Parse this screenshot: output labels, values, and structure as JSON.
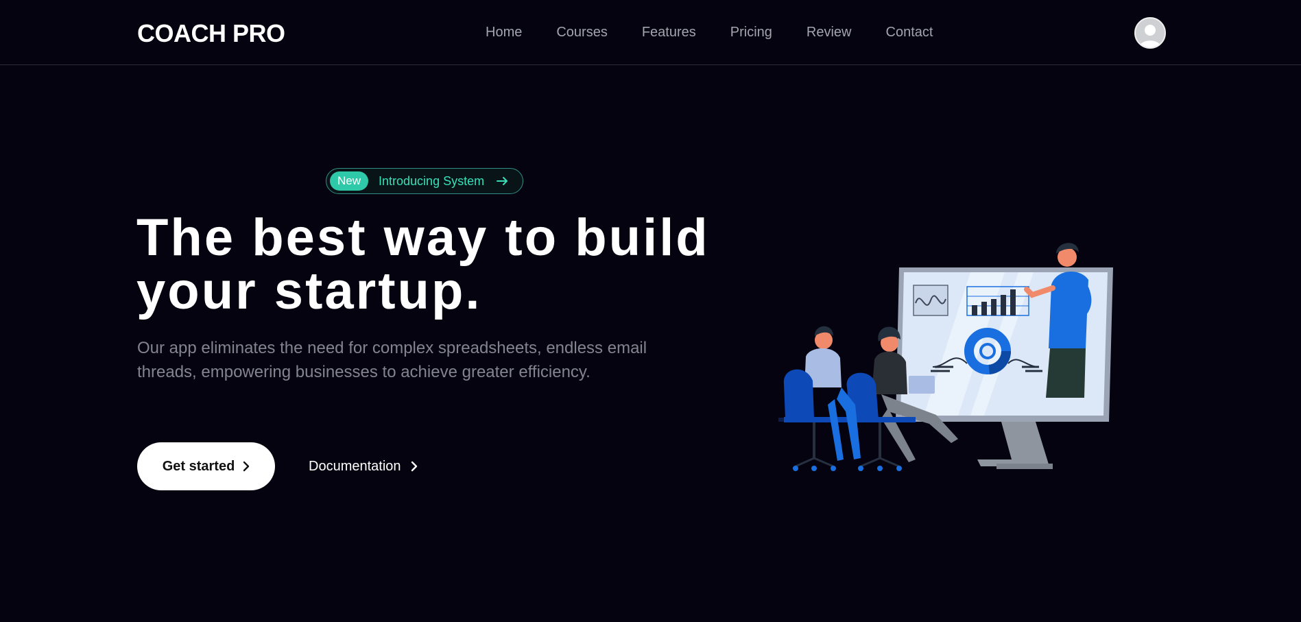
{
  "header": {
    "logo": "COACH PRO",
    "nav": [
      "Home",
      "Courses",
      "Features",
      "Pricing",
      "Review",
      "Contact"
    ]
  },
  "badge": {
    "tag": "New",
    "text": "Introducing System"
  },
  "hero": {
    "title": "The best way to build your startup.",
    "subtitle": "Our app eliminates the need for complex spreadsheets, endless email threads, empowering businesses to achieve greater efficiency.",
    "primary_button": "Get started",
    "secondary_button": "Documentation"
  },
  "colors": {
    "background": "#05030f",
    "accent": "#2ec9a8",
    "illustration_blue": "#1a6fe0"
  },
  "icons": [
    "avatar-icon",
    "arrow-right-icon",
    "chevron-right-icon",
    "presentation-illustration"
  ]
}
